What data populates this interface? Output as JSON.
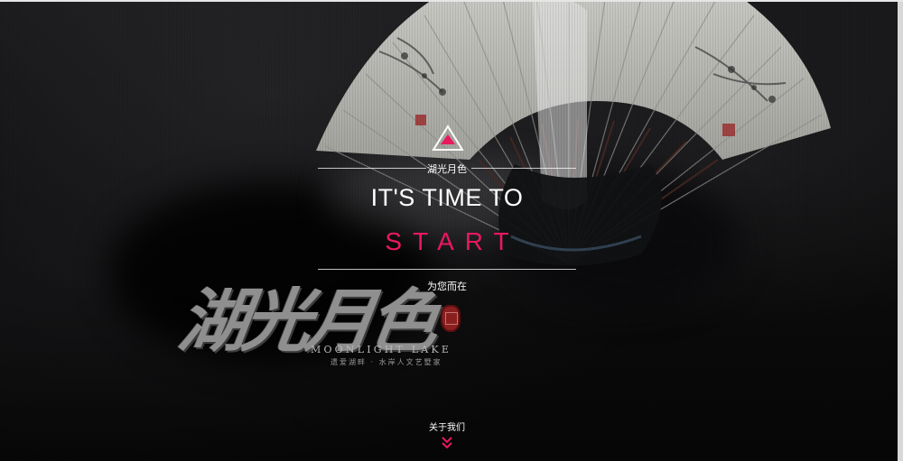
{
  "hero": {
    "subtitle": "湖光月色",
    "headline": "IT'S TIME TO",
    "cta_word": "START",
    "tagline": "为您而在"
  },
  "brand": {
    "calligraphy": "湖光月色",
    "english_name": "MOONLIGHT LAKE",
    "motto": "遗爱湖畔 · 水岸人文艺墅家"
  },
  "footer": {
    "about_label": "关于我们"
  },
  "icons": {
    "logo": "triangle-logo-icon",
    "scroll": "double-chevron-down-icon",
    "seal": "seal-icon"
  },
  "colors": {
    "accent": "#e8195e",
    "text": "#ffffff",
    "background": "#0b0b0c"
  }
}
